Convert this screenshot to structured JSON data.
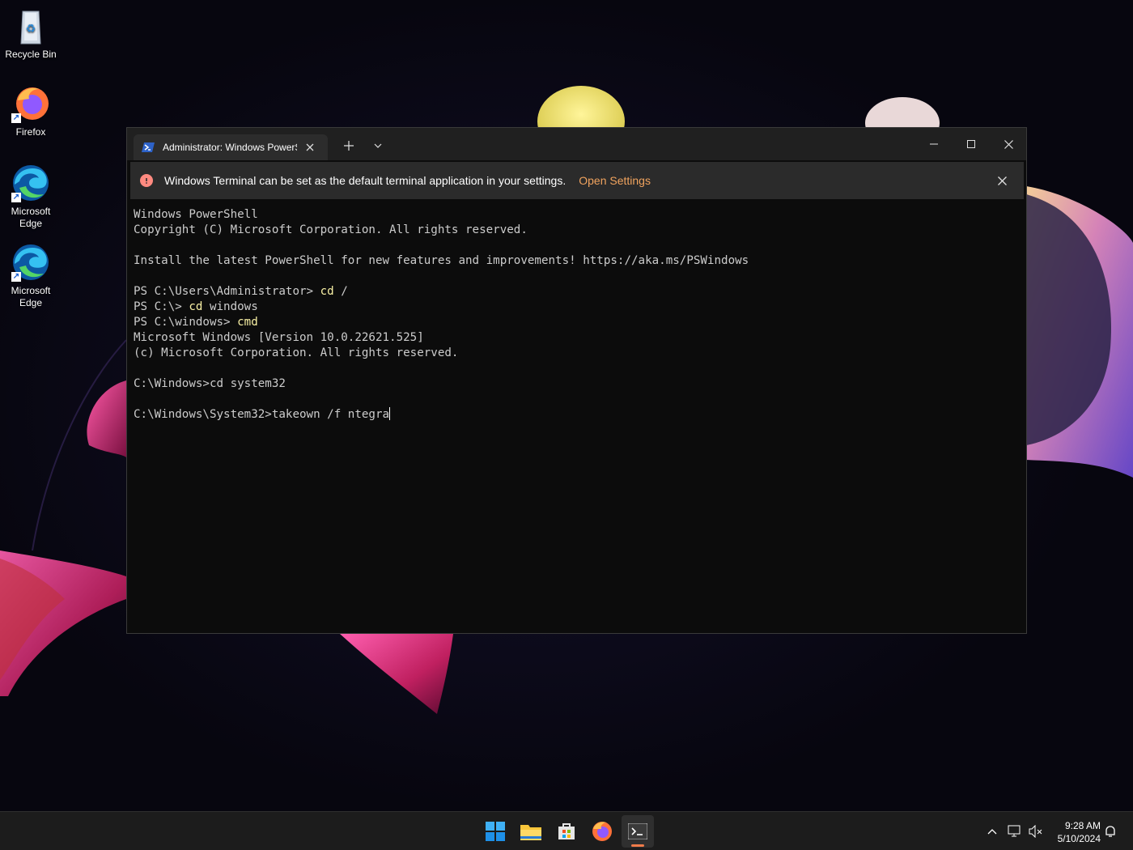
{
  "desktop": {
    "icons": [
      {
        "label": "Recycle Bin"
      },
      {
        "label": "Firefox"
      },
      {
        "label": "Microsoft Edge"
      },
      {
        "label": "Microsoft Edge"
      }
    ]
  },
  "terminal": {
    "tab_title": "Administrator: Windows PowerShell",
    "infobar": {
      "message": "Windows Terminal can be set as the default terminal application in your settings.",
      "link": "Open Settings"
    },
    "lines": [
      {
        "text": "Windows PowerShell"
      },
      {
        "text": "Copyright (C) Microsoft Corporation. All rights reserved."
      },
      {
        "text": ""
      },
      {
        "text": "Install the latest PowerShell for new features and improvements! https://aka.ms/PSWindows"
      },
      {
        "text": ""
      },
      {
        "prompt": "PS C:\\Users\\Administrator> ",
        "cmd": "cd",
        "rest": " /"
      },
      {
        "prompt": "PS C:\\> ",
        "cmd": "cd",
        "rest": " windows"
      },
      {
        "prompt": "PS C:\\windows> ",
        "cmd": "cmd",
        "rest": ""
      },
      {
        "text": "Microsoft Windows [Version 10.0.22621.525]"
      },
      {
        "text": "(c) Microsoft Corporation. All rights reserved."
      },
      {
        "text": ""
      },
      {
        "text": "C:\\Windows>cd system32"
      },
      {
        "text": ""
      },
      {
        "text": "C:\\Windows\\System32>takeown /f ntegra",
        "cursor": true
      }
    ],
    "colors": {
      "background": "#0c0c0c",
      "foreground": "#cccccc",
      "command": "#f9f1a5",
      "link": "#f0a35e"
    }
  },
  "taskbar": {
    "apps": [
      "start-icon",
      "file-explorer-icon",
      "store-icon",
      "firefox-icon",
      "terminal-icon"
    ],
    "clock": {
      "time": "9:28 AM",
      "date": "5/10/2024"
    }
  }
}
